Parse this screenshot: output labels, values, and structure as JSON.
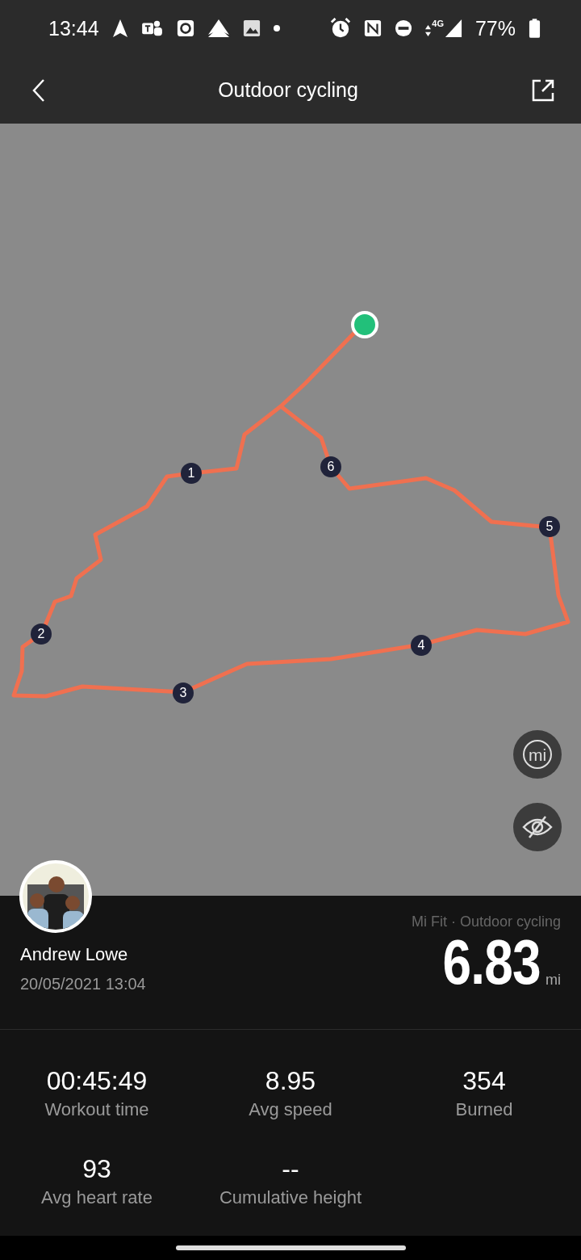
{
  "status_bar": {
    "time": "13:44",
    "network": "4G",
    "battery": "77%"
  },
  "header": {
    "title": "Outdoor cycling"
  },
  "map": {
    "markers": [
      "1",
      "2",
      "3",
      "4",
      "5",
      "6"
    ],
    "logo_button": "mi"
  },
  "summary": {
    "user": "Andrew Lowe",
    "date": "20/05/2021 13:04",
    "source": "Mi Fit · Outdoor cycling",
    "distance": "6.83",
    "unit": "mi"
  },
  "stats": [
    {
      "value": "00:45:49",
      "label": "Workout time"
    },
    {
      "value": "8.95",
      "label": "Avg speed"
    },
    {
      "value": "354",
      "label": "Burned"
    },
    {
      "value": "93",
      "label": "Avg heart rate"
    },
    {
      "value": "--",
      "label": "Cumulative height"
    }
  ]
}
